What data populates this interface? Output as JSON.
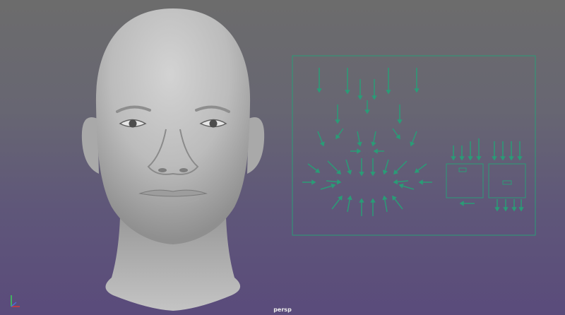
{
  "viewport": {
    "camera_label": "persp",
    "background_top": "#6c6c6c",
    "background_bottom": "#5a4b7b"
  },
  "model": {
    "skin_color": "#bcbcbc"
  },
  "rig": {
    "line_color": "#2a9c77",
    "joystick_count": 2
  },
  "axis_gizmo": {
    "x_color": "#d43a3a",
    "y_color": "#3bd25a",
    "z_color": "#4a6cd6"
  }
}
